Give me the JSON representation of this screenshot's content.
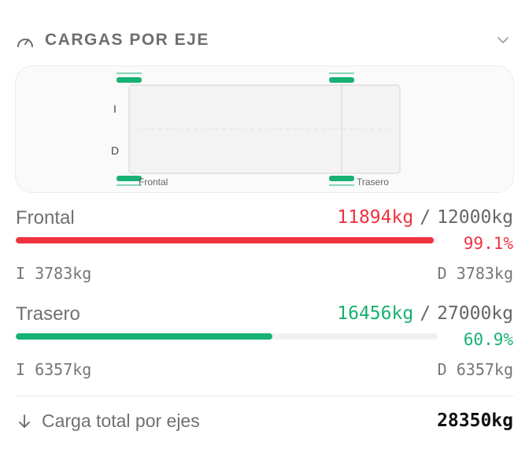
{
  "header": {
    "icon": "gauge-icon",
    "title": "CARGAS POR EJE",
    "toggle_icon": "chevron-down-icon"
  },
  "diagram": {
    "side_left_label": "I",
    "side_right_label": "D",
    "front_axle_label": "Frontal",
    "rear_axle_label": "Trasero",
    "wheel_color": "#16b173"
  },
  "axles": [
    {
      "name": "Frontal",
      "current": "11894kg",
      "separator": "/",
      "max": "12000kg",
      "percent_text": "99.1%",
      "percent": 99.1,
      "status": "over",
      "color": "#ef3340",
      "left": "I 3783kg",
      "right": "D 3783kg"
    },
    {
      "name": "Trasero",
      "current": "16456kg",
      "separator": "/",
      "max": "27000kg",
      "percent_text": "60.9%",
      "percent": 60.9,
      "status": "ok",
      "color": "#16b173",
      "left": "I 6357kg",
      "right": "D 6357kg"
    }
  ],
  "total": {
    "icon": "arrow-down-icon",
    "label": "Carga total por ejes",
    "value": "28350kg"
  }
}
